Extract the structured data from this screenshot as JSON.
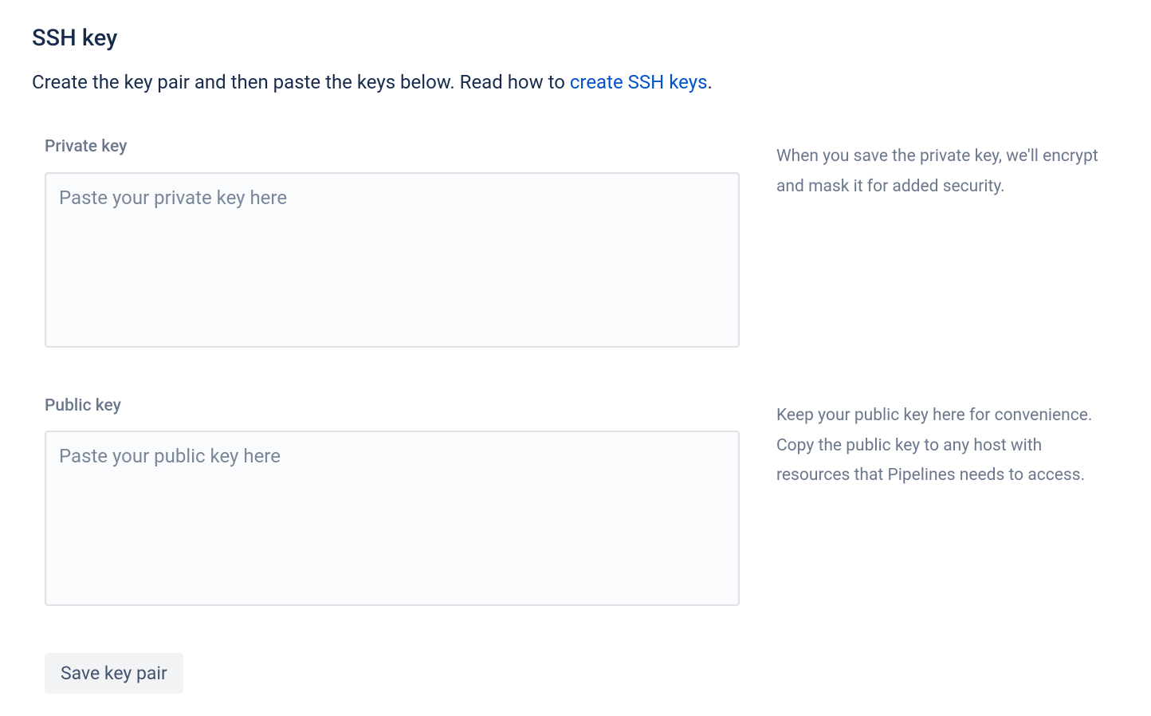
{
  "header": {
    "title": "SSH key",
    "description_prefix": "Create the key pair and then paste the keys below. Read how to ",
    "description_link": "create SSH keys",
    "description_suffix": "."
  },
  "fields": {
    "private_key": {
      "label": "Private key",
      "placeholder": "Paste your private key here",
      "help": "When you save the private key, we'll encrypt and mask it for added security."
    },
    "public_key": {
      "label": "Public key",
      "placeholder": "Paste your public key here",
      "help": "Keep your public key here for convenience. Copy the public key to any host with resources that Pipelines needs to access."
    }
  },
  "actions": {
    "save_label": "Save key pair"
  }
}
